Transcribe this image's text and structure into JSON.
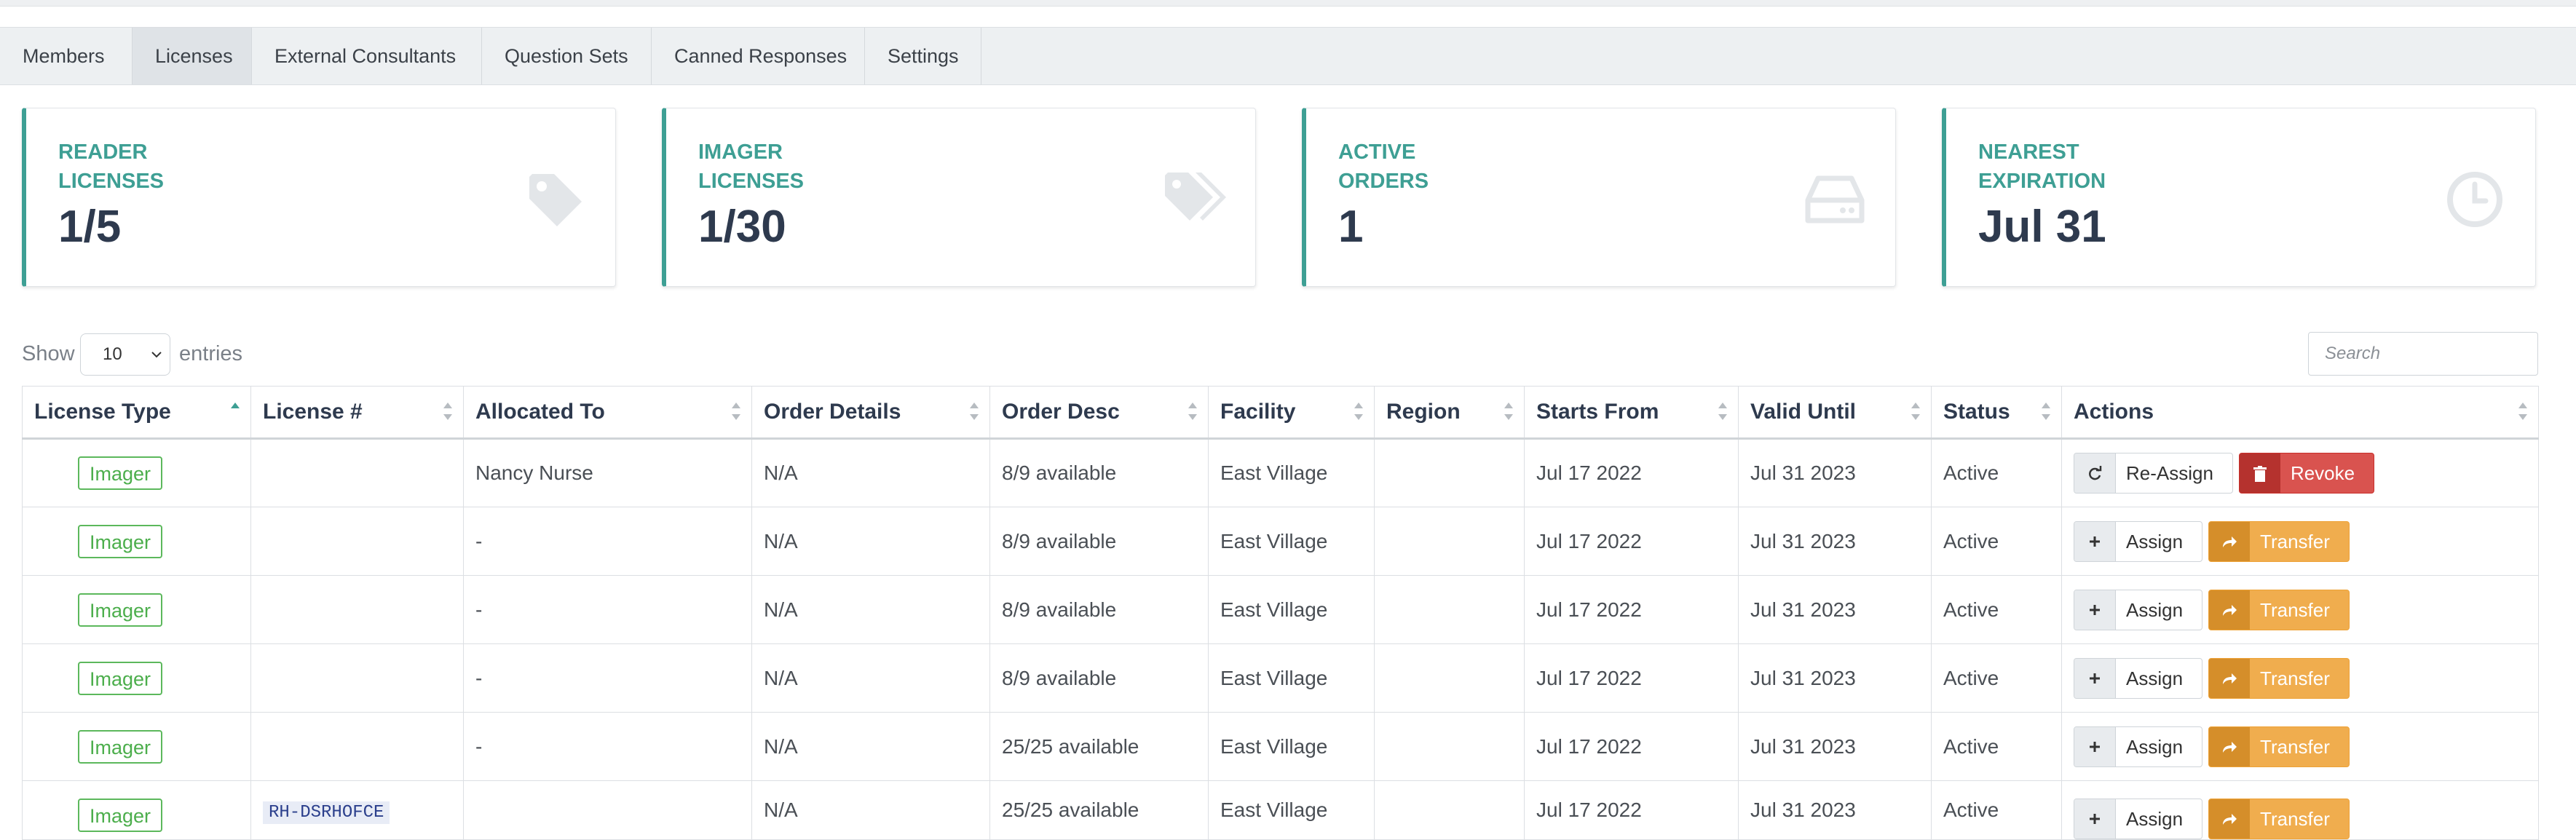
{
  "tabs": [
    {
      "label": "Members",
      "active": false
    },
    {
      "label": "Licenses",
      "active": true
    },
    {
      "label": "External Consultants",
      "active": false
    },
    {
      "label": "Question Sets",
      "active": false
    },
    {
      "label": "Canned Responses",
      "active": false
    },
    {
      "label": "Settings",
      "active": false
    }
  ],
  "cards": [
    {
      "title_line1": "READER",
      "title_line2": "LICENSES",
      "value": "1/5",
      "icon": "tag-icon"
    },
    {
      "title_line1": "IMAGER",
      "title_line2": "LICENSES",
      "value": "1/30",
      "icon": "tags-icon"
    },
    {
      "title_line1": "ACTIVE",
      "title_line2": "ORDERS",
      "value": "1",
      "icon": "hdd-icon"
    },
    {
      "title_line1": "NEAREST",
      "title_line2": "EXPIRATION",
      "value": "Jul 31",
      "icon": "clock-icon"
    }
  ],
  "colors": {
    "accent": "#3e9f94",
    "success": "#5cb85c",
    "danger": "#d9534f",
    "warning": "#f0ad4e"
  },
  "entries": {
    "show": "Show",
    "value": "10",
    "suffix": "entries"
  },
  "search": {
    "placeholder": "Search"
  },
  "table": {
    "columns": [
      "License Type",
      "License #",
      "Allocated To",
      "Order Details",
      "Order Desc",
      "Facility",
      "Region",
      "Starts From",
      "Valid Until",
      "Status",
      "Actions"
    ],
    "rows": [
      {
        "type": "Imager",
        "license": "",
        "allocated": "Nancy Nurse",
        "order_details": "N/A",
        "order_desc": "8/9 available",
        "facility": "East Village",
        "region": "",
        "starts": "Jul 17 2022",
        "valid": "Jul 31 2023",
        "status": "Active",
        "action1": "Re-Assign",
        "action2": "Revoke"
      },
      {
        "type": "Imager",
        "license": "",
        "allocated": "-",
        "order_details": "N/A",
        "order_desc": "8/9 available",
        "facility": "East Village",
        "region": "",
        "starts": "Jul 17 2022",
        "valid": "Jul 31 2023",
        "status": "Active",
        "action1": "Assign",
        "action2": "Transfer"
      },
      {
        "type": "Imager",
        "license": "",
        "allocated": "-",
        "order_details": "N/A",
        "order_desc": "8/9 available",
        "facility": "East Village",
        "region": "",
        "starts": "Jul 17 2022",
        "valid": "Jul 31 2023",
        "status": "Active",
        "action1": "Assign",
        "action2": "Transfer"
      },
      {
        "type": "Imager",
        "license": "",
        "allocated": "-",
        "order_details": "N/A",
        "order_desc": "8/9 available",
        "facility": "East Village",
        "region": "",
        "starts": "Jul 17 2022",
        "valid": "Jul 31 2023",
        "status": "Active",
        "action1": "Assign",
        "action2": "Transfer"
      },
      {
        "type": "Imager",
        "license": "",
        "allocated": "-",
        "order_details": "N/A",
        "order_desc": "25/25 available",
        "facility": "East Village",
        "region": "",
        "starts": "Jul 17 2022",
        "valid": "Jul 31 2023",
        "status": "Active",
        "action1": "Assign",
        "action2": "Transfer"
      },
      {
        "type": "Imager",
        "license": "RH-DSRHOFCE",
        "allocated": "",
        "order_details": "N/A",
        "order_desc": "25/25 available",
        "facility": "East Village",
        "region": "",
        "starts": "Jul 17 2022",
        "valid": "Jul 31 2023",
        "status": "Active",
        "action1": "Assign",
        "action2": "Transfer"
      }
    ]
  }
}
